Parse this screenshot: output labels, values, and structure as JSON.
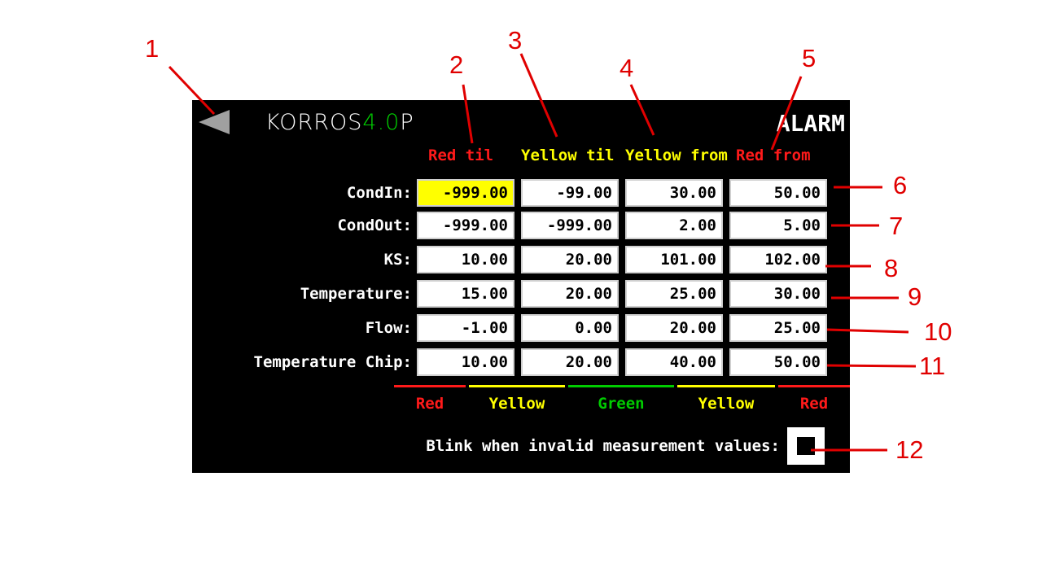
{
  "header": {
    "logo_main": "KORROS",
    "logo_accent": "4.0",
    "logo_tail": "P",
    "title": "ALARM"
  },
  "columns": [
    {
      "label": "Red til",
      "color": "#ff1a1a"
    },
    {
      "label": "Yellow til",
      "color": "#ffff00"
    },
    {
      "label": "Yellow from",
      "color": "#ffff00"
    },
    {
      "label": "Red from",
      "color": "#ff1a1a"
    }
  ],
  "rows": [
    {
      "label": "CondIn:",
      "values": [
        "-999.00",
        "-99.00",
        "30.00",
        "50.00"
      ],
      "highlighted_col": 0
    },
    {
      "label": "CondOut:",
      "values": [
        "-999.00",
        "-999.00",
        "2.00",
        "5.00"
      ]
    },
    {
      "label": "KS:",
      "values": [
        "10.00",
        "20.00",
        "101.00",
        "102.00"
      ]
    },
    {
      "label": "Temperature:",
      "values": [
        "15.00",
        "20.00",
        "25.00",
        "30.00"
      ]
    },
    {
      "label": "Flow:",
      "values": [
        "-1.00",
        "0.00",
        "20.00",
        "25.00"
      ]
    },
    {
      "label": "Temperature Chip:",
      "values": [
        "10.00",
        "20.00",
        "40.00",
        "50.00"
      ]
    }
  ],
  "bands": [
    {
      "label": "Red",
      "color": "#ff1a1a"
    },
    {
      "label": "Yellow",
      "color": "#ffff00"
    },
    {
      "label": "Green",
      "color": "#00cc00"
    },
    {
      "label": "Yellow",
      "color": "#ffff00"
    },
    {
      "label": "Red",
      "color": "#ff1a1a"
    }
  ],
  "blink": {
    "label": "Blink when invalid measurement values:",
    "checked": true
  },
  "callouts": [
    "1",
    "2",
    "3",
    "4",
    "5",
    "6",
    "7",
    "8",
    "9",
    "10",
    "11",
    "12"
  ],
  "icons": {
    "back": "back-triangle-icon"
  }
}
